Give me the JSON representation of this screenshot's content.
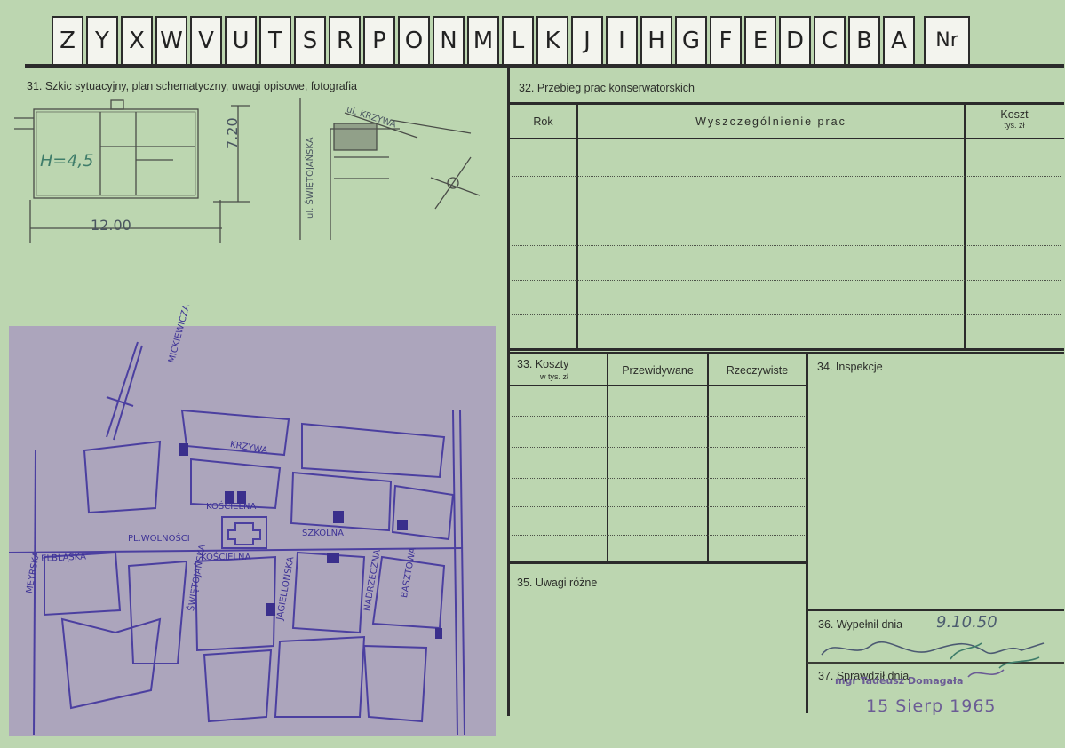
{
  "header": {
    "letters": [
      "Z",
      "Y",
      "X",
      "W",
      "V",
      "U",
      "T",
      "S",
      "R",
      "P",
      "O",
      "N",
      "M",
      "L",
      "K",
      "J",
      "I",
      "H",
      "G",
      "F",
      "E",
      "D",
      "C",
      "B",
      "A"
    ],
    "nr_label": "Nr"
  },
  "section31": {
    "label": "31. Szkic sytuacyjny, plan schematyczny, uwagi opisowe, fotografia",
    "sketch": {
      "height_note": "H=4,5",
      "width_dim": "12.00",
      "depth_dim": "7.20",
      "street_1": "ul. ŚWIĘTOJAŃSKA",
      "street_2": "ul. KRZYWA"
    },
    "map": {
      "streets": [
        "MICKIEWICZA",
        "KRZYWA",
        "KOŚCIELNA",
        "SZKOLNA",
        "PL.WOLNOŚCI",
        "KOŚCIELNA",
        "ELBLĄSKA",
        "MEYRSKA",
        "ŚWIĘTOJAŃSKA",
        "JAGIELLOŃSKA",
        "NADRZECZNA",
        "BASZTOWA"
      ]
    }
  },
  "section32": {
    "label": "32. Przebieg prac konserwatorskich",
    "col_rok": "Rok",
    "col_prace": "Wyszczególnienie prac",
    "col_koszt": "Koszt",
    "col_koszt_sub": "tys. zł"
  },
  "section33": {
    "label": "33. Koszty",
    "label_sub": "w tys. zł",
    "col_przewidywane": "Przewidywane",
    "col_rzeczywiste": "Rzeczywiste"
  },
  "section34": {
    "label": "34. Inspekcje"
  },
  "section35": {
    "label": "35. Uwagi różne"
  },
  "section36": {
    "label": "36. Wypełnił dnia",
    "date_handwritten": "9.10.50"
  },
  "section37": {
    "label": "37. Sprawdził dnia",
    "stamp_name": "mgr Tadeusz Domagała",
    "stamp_date": "15 Sierp 1965"
  },
  "colors": {
    "card": "#bcd6b0",
    "ink": "#2b2b2b",
    "stamp": "#6b5c95",
    "map": "#aca5bc"
  }
}
